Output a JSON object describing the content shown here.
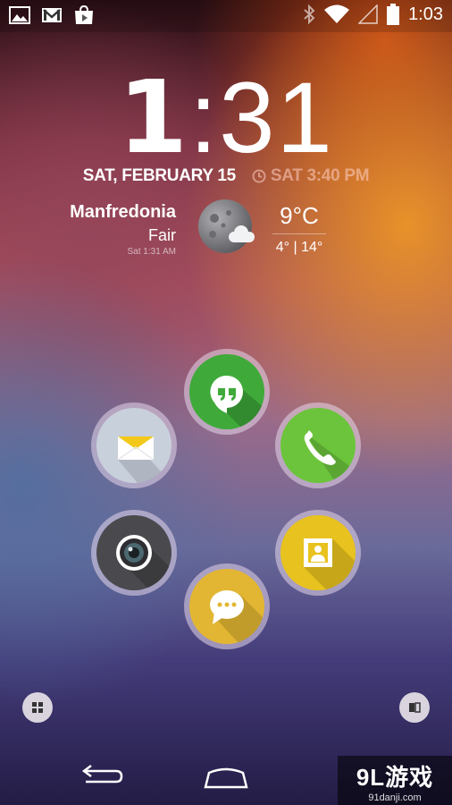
{
  "status_bar": {
    "time": "1:03",
    "left_icons": [
      "gallery-icon",
      "gmail-icon",
      "play-store-icon"
    ],
    "right_icons": [
      "bluetooth-icon",
      "wifi-icon",
      "signal-icon",
      "battery-icon"
    ]
  },
  "clock": {
    "hour": "1",
    "separator": ":",
    "minutes": "31"
  },
  "date": {
    "day": "SAT, FEBRUARY 15",
    "alarm": "SAT 3:40 PM"
  },
  "weather": {
    "city": "Manfredonia",
    "condition": "Fair",
    "updated": "Sat 1:31 AM",
    "temperature": "9°C",
    "range": "4° | 14°",
    "icon": "moon-cloud-icon"
  },
  "apps": [
    {
      "name": "hangouts",
      "icon": "hangouts-icon",
      "color": "#3faa3a"
    },
    {
      "name": "email",
      "icon": "email-icon",
      "color": "#c8d0dc"
    },
    {
      "name": "phone",
      "icon": "phone-icon",
      "color": "#6cc43c"
    },
    {
      "name": "camera",
      "icon": "camera-icon",
      "color": "#4a4a4e"
    },
    {
      "name": "gallery",
      "icon": "photo-icon",
      "color": "#e8c21e"
    },
    {
      "name": "messaging",
      "icon": "message-icon",
      "color": "#e2b632"
    }
  ],
  "navigation": {
    "icons": [
      "back-icon",
      "home-icon"
    ]
  },
  "watermark": {
    "title": "9L游戏",
    "url": "91danji.com"
  }
}
